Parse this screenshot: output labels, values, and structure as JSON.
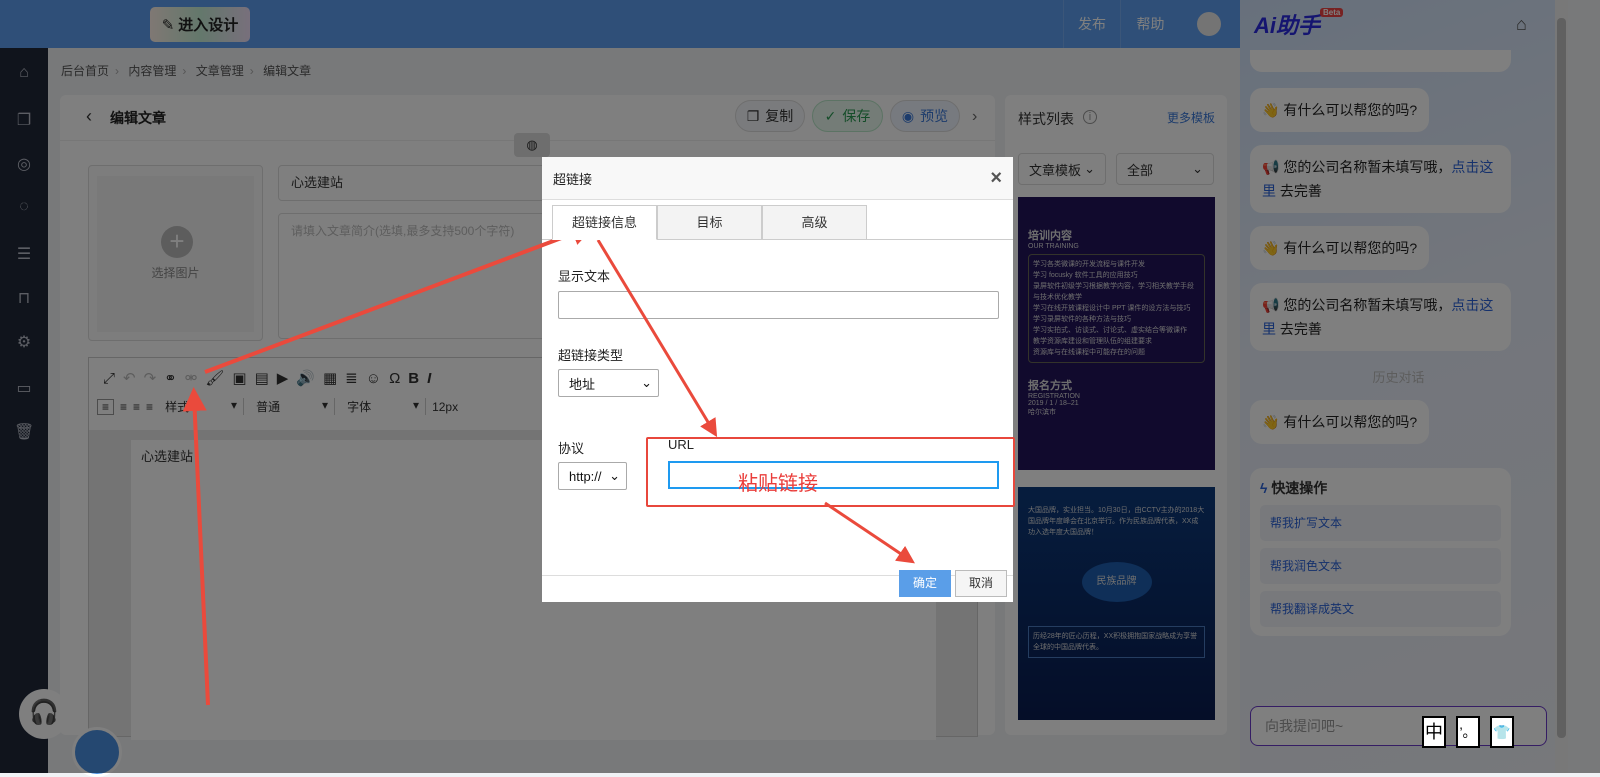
{
  "topbar": {
    "design_button": "进入设计",
    "publish": "发布",
    "help": "帮助"
  },
  "breadcrumb": [
    "后台首页",
    "内容管理",
    "文章管理",
    "编辑文章"
  ],
  "header": {
    "title": "编辑文章",
    "copy": "复制",
    "save": "保存",
    "preview": "预览"
  },
  "form": {
    "cover_label": "选择图片",
    "title_value": "心选建站",
    "summary_placeholder": "请填入文章简介(选填,最多支持500个字符)"
  },
  "editor": {
    "style": "样式",
    "paragraph": "普通",
    "font": "字体",
    "size": "12px",
    "content": "心选建站"
  },
  "style_panel": {
    "title": "样式列表",
    "more": "更多模板",
    "filter1": "文章模板",
    "filter2": "全部",
    "tpl1": {
      "heading": "培训内容",
      "sub": "OUR TRAINING",
      "items": [
        "学习各类微课的开发流程与课件开发",
        "学习 focusky 软件工具的应用技巧",
        "录屏软件初级学习根据教学内容，学习相关教学手段与技术优化教学",
        "学习在线开放课程设计中 PPT 课件的设方法与技巧",
        "学习录屏软件的各种方法与技巧",
        "学习实拍式、访谈式、讨论式、虚实结合等微课作",
        "教学资源库建设和管理队伍的组建要求",
        "资源库与在线课程中可能存在的问题"
      ],
      "reg": "报名方式",
      "reg_sub": "REGISTRATION",
      "date": "2019 / 1 / 18–21",
      "city": "哈尔滨市"
    },
    "tpl2": {
      "text": "大国品牌，实业担当。10月30日，由CCTV主办的2018大国品牌年度峰会在北京举行。作为民族品牌代表，XX成功入选年度大国品牌！",
      "badge": "民族品牌",
      "text2": "历经28年的匠心历程，XX积极拥抱国家战略成为享誉全球的中国品牌代表。"
    }
  },
  "ai": {
    "title": "Ai助手",
    "beta": "Beta",
    "greeting": "有什么可以帮您的吗?",
    "notice": "您的公司名称暂未填写哦，",
    "notice_link": "点击这里",
    "notice_tail": "去完善",
    "history": "历史对话",
    "quick_title": "快速操作",
    "quick": [
      "帮我扩写文本",
      "帮我润色文本",
      "帮我翻译成英文"
    ],
    "ask_placeholder": "向我提问吧~"
  },
  "dialog": {
    "title": "超链接",
    "tabs": [
      "超链接信息",
      "目标",
      "高级"
    ],
    "display_text_label": "显示文本",
    "link_type_label": "超链接类型",
    "link_type": "地址",
    "protocol_label": "协议",
    "protocol": "http://",
    "url_label": "URL",
    "ok": "确定",
    "cancel": "取消"
  },
  "annotation": {
    "paste": "粘贴链接"
  },
  "ime": [
    "中",
    "’。",
    "👕"
  ]
}
